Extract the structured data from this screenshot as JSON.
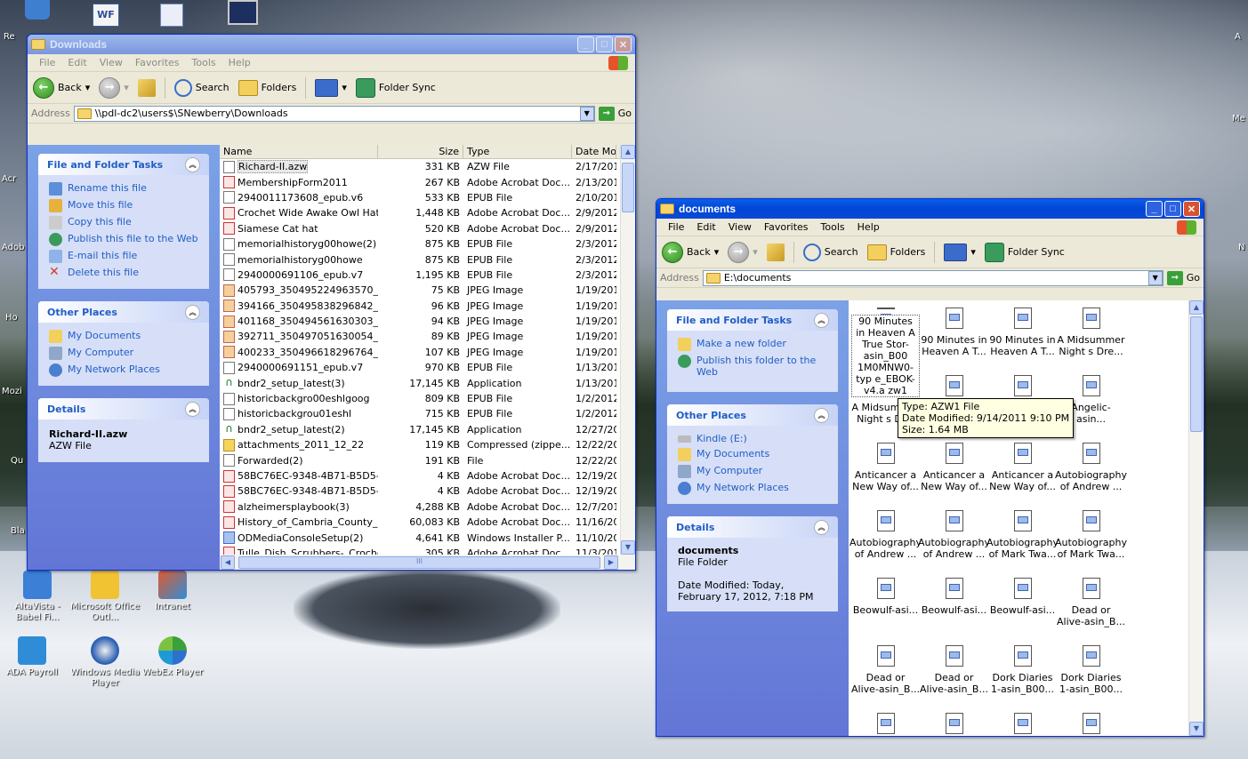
{
  "desktop": {
    "edge_labels": [
      "Re",
      "Acr",
      "Adob",
      "Ho",
      "Mozi",
      "Qu",
      "Bla",
      "A",
      "Me",
      "N"
    ],
    "icons": [
      {
        "label": "AltaVista - Babel Fi...",
        "icon": "altavista-icon"
      },
      {
        "label": "Microsoft Office Outl...",
        "icon": "outlook-icon"
      },
      {
        "label": "Intranet",
        "icon": "intranet-icon"
      },
      {
        "label": "ADA Payroll",
        "icon": "payroll-icon"
      },
      {
        "label": "Windows Media Player",
        "icon": "media-player-icon"
      },
      {
        "label": "WebEx Player",
        "icon": "webex-icon"
      }
    ]
  },
  "downloads": {
    "title": "Downloads",
    "menu": [
      "File",
      "Edit",
      "View",
      "Favorites",
      "Tools",
      "Help"
    ],
    "toolbar": {
      "back": "Back",
      "search": "Search",
      "folders": "Folders",
      "sync": "Folder Sync"
    },
    "address_label": "Address",
    "address": "\\\\pdl-dc2\\users$\\SNewberry\\Downloads",
    "go": "Go",
    "tasks": {
      "title": "File and Folder Tasks",
      "items": [
        "Rename this file",
        "Move this file",
        "Copy this file",
        "Publish this file to the Web",
        "E-mail this file",
        "Delete this file"
      ]
    },
    "other": {
      "title": "Other Places",
      "items": [
        "My Documents",
        "My Computer",
        "My Network Places"
      ]
    },
    "details": {
      "title": "Details",
      "name": "Richard-II.azw",
      "type": "AZW File"
    },
    "columns": [
      "Name",
      "Size",
      "Type",
      "Date Mo"
    ],
    "files": [
      {
        "name": "Richard-II.azw",
        "size": "331 KB",
        "type": "AZW File",
        "date": "2/17/201",
        "kind": "doc"
      },
      {
        "name": "MembershipForm2011",
        "size": "267 KB",
        "type": "Adobe Acrobat Doc...",
        "date": "2/13/201",
        "kind": "pdf"
      },
      {
        "name": "2940011173608_epub.v6",
        "size": "533 KB",
        "type": "EPUB File",
        "date": "2/10/201",
        "kind": "doc"
      },
      {
        "name": "Crochet Wide Awake Owl Hat",
        "size": "1,448 KB",
        "type": "Adobe Acrobat Doc...",
        "date": "2/9/2012",
        "kind": "pdf"
      },
      {
        "name": "Siamese Cat hat",
        "size": "520 KB",
        "type": "Adobe Acrobat Doc...",
        "date": "2/9/2012",
        "kind": "pdf"
      },
      {
        "name": "memorialhistoryg00howe(2)",
        "size": "875 KB",
        "type": "EPUB File",
        "date": "2/3/2012",
        "kind": "doc"
      },
      {
        "name": "memorialhistoryg00howe",
        "size": "875 KB",
        "type": "EPUB File",
        "date": "2/3/2012",
        "kind": "doc"
      },
      {
        "name": "2940000691106_epub.v7",
        "size": "1,195 KB",
        "type": "EPUB File",
        "date": "2/3/2012",
        "kind": "doc"
      },
      {
        "name": "405793_350495224963570_1...",
        "size": "75 KB",
        "type": "JPEG Image",
        "date": "1/19/201",
        "kind": "jpg"
      },
      {
        "name": "394166_350495838296842_1...",
        "size": "96 KB",
        "type": "JPEG Image",
        "date": "1/19/201",
        "kind": "jpg"
      },
      {
        "name": "401168_350494561630303_1...",
        "size": "94 KB",
        "type": "JPEG Image",
        "date": "1/19/201",
        "kind": "jpg"
      },
      {
        "name": "392711_350497051630054_1...",
        "size": "89 KB",
        "type": "JPEG Image",
        "date": "1/19/201",
        "kind": "jpg"
      },
      {
        "name": "400233_350496618296764_1...",
        "size": "107 KB",
        "type": "JPEG Image",
        "date": "1/19/201",
        "kind": "jpg"
      },
      {
        "name": "2940000691151_epub.v7",
        "size": "970 KB",
        "type": "EPUB File",
        "date": "1/13/201",
        "kind": "doc"
      },
      {
        "name": "bndr2_setup_latest(3)",
        "size": "17,145 KB",
        "type": "Application",
        "date": "1/13/201",
        "kind": "app"
      },
      {
        "name": "historicbackgro00eshlgoog",
        "size": "809 KB",
        "type": "EPUB File",
        "date": "1/2/2012",
        "kind": "doc"
      },
      {
        "name": "historicbackgrou01eshl",
        "size": "715 KB",
        "type": "EPUB File",
        "date": "1/2/2012",
        "kind": "doc"
      },
      {
        "name": "bndr2_setup_latest(2)",
        "size": "17,145 KB",
        "type": "Application",
        "date": "12/27/20",
        "kind": "app"
      },
      {
        "name": "attachments_2011_12_22",
        "size": "119 KB",
        "type": "Compressed (zippe...",
        "date": "12/22/20",
        "kind": "zip"
      },
      {
        "name": "Forwarded(2)",
        "size": "191 KB",
        "type": "File",
        "date": "12/22/20",
        "kind": "doc"
      },
      {
        "name": "58BC76EC-9348-4B71-B5D5-...",
        "size": "4 KB",
        "type": "Adobe Acrobat Doc...",
        "date": "12/19/20",
        "kind": "pdf"
      },
      {
        "name": "58BC76EC-9348-4B71-B5D5-...",
        "size": "4 KB",
        "type": "Adobe Acrobat Doc...",
        "date": "12/19/20",
        "kind": "pdf"
      },
      {
        "name": "alzheimersplaybook(3)",
        "size": "4,288 KB",
        "type": "Adobe Acrobat Doc...",
        "date": "12/7/201",
        "kind": "pdf"
      },
      {
        "name": "History_of_Cambria_County_...",
        "size": "60,083 KB",
        "type": "Adobe Acrobat Doc...",
        "date": "11/16/20",
        "kind": "pdf"
      },
      {
        "name": "ODMediaConsoleSetup(2)",
        "size": "4,641 KB",
        "type": "Windows Installer P...",
        "date": "11/10/20",
        "kind": "msi"
      },
      {
        "name": "Tulle_Dish_Scrubbers-_Crochet",
        "size": "305 KB",
        "type": "Adobe Acrobat Doc...",
        "date": "11/3/201",
        "kind": "pdf"
      }
    ],
    "hscroll_grip": "III"
  },
  "documents": {
    "title": "documents",
    "menu": [
      "File",
      "Edit",
      "View",
      "Favorites",
      "Tools",
      "Help"
    ],
    "toolbar": {
      "back": "Back",
      "search": "Search",
      "folders": "Folders",
      "sync": "Folder Sync"
    },
    "address_label": "Address",
    "address": "E:\\documents",
    "go": "Go",
    "tasks": {
      "title": "File and Folder Tasks",
      "items": [
        "Make a new folder",
        "Publish this folder to the Web"
      ]
    },
    "other": {
      "title": "Other Places",
      "items": [
        "Kindle (E:)",
        "My Documents",
        "My Computer",
        "My Network Places"
      ]
    },
    "details": {
      "title": "Details",
      "name": "documents",
      "type": "File Folder",
      "modified": "Date Modified: Today, February 17, 2012, 7:18 PM"
    },
    "tiles": [
      [
        "90 Minutes in Heaven A True Stor-asin_B00 1M0MNW0-typ e_EBOK-v4.a zw1",
        "90 Minutes in Heaven A T...",
        "90 Minutes in Heaven A T...",
        "A Midsummer Night s Dre..."
      ],
      [
        "A Midsummer Night s Dr...",
        "",
        "",
        "Angelic-asin..."
      ],
      [
        "Anticancer a New Way of...",
        "Anticancer a New Way of...",
        "Anticancer a New Way of...",
        "Autobiography of Andrew ..."
      ],
      [
        "Autobiography of Andrew ...",
        "Autobiography of Andrew ...",
        "Autobiography of Mark Twa...",
        "Autobiography of Mark Twa..."
      ],
      [
        "Beowulf-asi...",
        "Beowulf-asi...",
        "Beowulf-asi...",
        "Dead or Alive-asin_B..."
      ],
      [
        "Dead or Alive-asin_B...",
        "Dead or Alive-asin_B...",
        "Dork Diaries 1-asin_B00...",
        "Dork Diaries 1-asin_B00..."
      ],
      [
        "",
        "",
        "",
        ""
      ]
    ],
    "tooltip": [
      "Type: AZW1 File",
      "Date Modified: 9/14/2011 9:10 PM",
      "Size: 1.64 MB"
    ]
  }
}
